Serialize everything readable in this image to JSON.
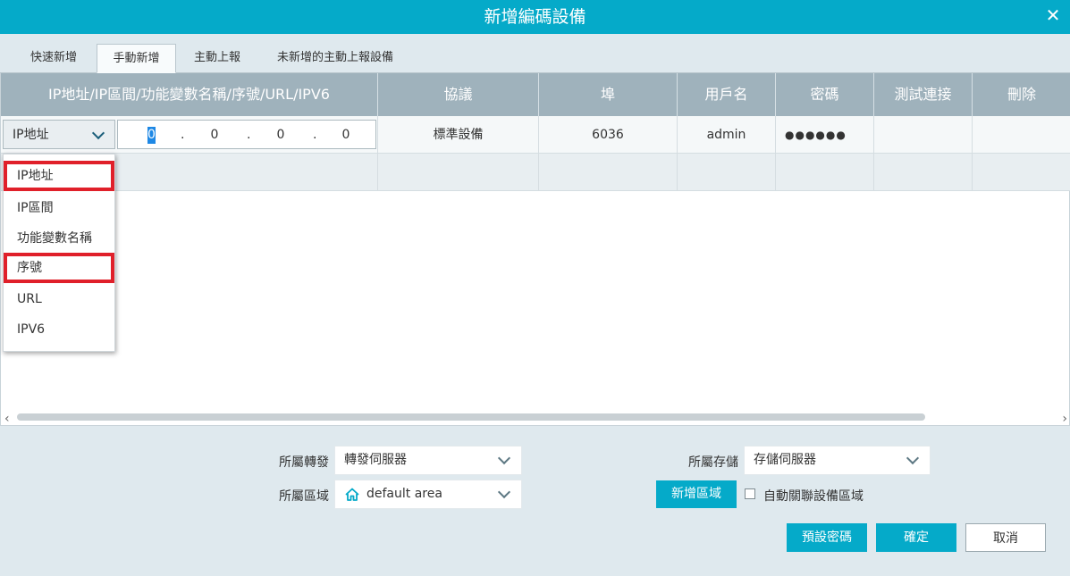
{
  "dialog": {
    "title": "新增編碼設備",
    "close_glyph": "✕"
  },
  "tabs": [
    {
      "label": "快速新增"
    },
    {
      "label": "手動新增"
    },
    {
      "label": "主動上報"
    },
    {
      "label": "未新增的主動上報設備"
    }
  ],
  "table": {
    "headers": [
      "IP地址/IP區間/功能變數名稱/序號/URL/IPV6",
      "協議",
      "埠",
      "用戶名",
      "密碼",
      "測試連接",
      "刪除"
    ],
    "row1": {
      "addr_type": "IP地址",
      "ip_octets": [
        "0",
        "0",
        "0",
        "0"
      ],
      "ip_dot": ".",
      "protocol": "標準設備",
      "port": "6036",
      "username": "admin",
      "password": "●●●●●●",
      "test": "",
      "delete": ""
    }
  },
  "dropdown": {
    "options": [
      "IP地址",
      "IP區間",
      "功能變數名稱",
      "序號",
      "URL",
      "IPV6"
    ],
    "highlight_color": "#e0202a"
  },
  "scrollbar": {
    "left_arrow": "‹",
    "right_arrow": "›"
  },
  "form": {
    "forward_label": "所屬轉發",
    "forward_value": "轉發伺服器",
    "storage_label": "所屬存儲",
    "storage_value": "存儲伺服器",
    "area_label": "所屬區域",
    "area_value": "default area",
    "add_area_button": "新增區域",
    "auto_link_label": "自動關聯設備區域"
  },
  "buttons": {
    "default_password": "預設密碼",
    "confirm": "確定",
    "cancel": "取消"
  },
  "colors": {
    "accent": "#05aac9",
    "header_bg": "#9fb2bc"
  }
}
